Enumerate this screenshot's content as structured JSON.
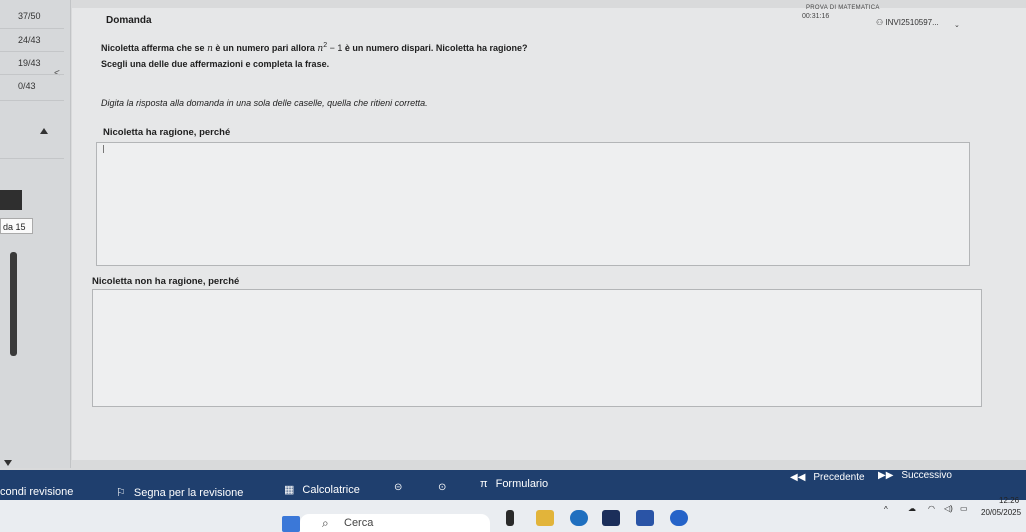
{
  "sidebar": {
    "stats": [
      "37/50",
      "24/43",
      "19/43",
      "0/43"
    ],
    "section_badge": "da 15"
  },
  "header": {
    "title": "Domanda",
    "exam_label": "PROVA DI MATEMATICA",
    "timer": "00:31:16",
    "user_id": "INVI2510597..."
  },
  "question": {
    "line1_part1": "Nicoletta afferma che se",
    "var_n": "n",
    "line1_part2": "è un numero pari allora",
    "expr": "n",
    "exp": "2",
    "expr_tail": "− 1",
    "line1_part3": "è un numero dispari. Nicoletta ha ragione?",
    "line2": "Scegli una delle due affermazioni e completa la frase.",
    "instruction": "Digita la risposta alla domanda in una sola delle caselle, quella che ritieni corretta."
  },
  "options": [
    {
      "label": "Nicoletta ha ragione, perché",
      "value": ""
    },
    {
      "label": "Nicoletta non ha ragione, perché",
      "value": ""
    }
  ],
  "toolbar": {
    "review": "condi revisione",
    "flag": "Segna per la revisione",
    "calculator": "Calcolatrice",
    "formulas": "Formulario",
    "prev": "Precedente",
    "next": "Successivo",
    "flag_icon": "flag-icon",
    "calc_icon": "calculator-icon",
    "pi_symbol": "π"
  },
  "taskbar": {
    "search_placeholder": "Cerca",
    "time": "12:26",
    "date": "20/05/2025"
  },
  "colors": {
    "toolbar_bg": "#1f3f6e",
    "page_bg": "#d9dadb"
  }
}
